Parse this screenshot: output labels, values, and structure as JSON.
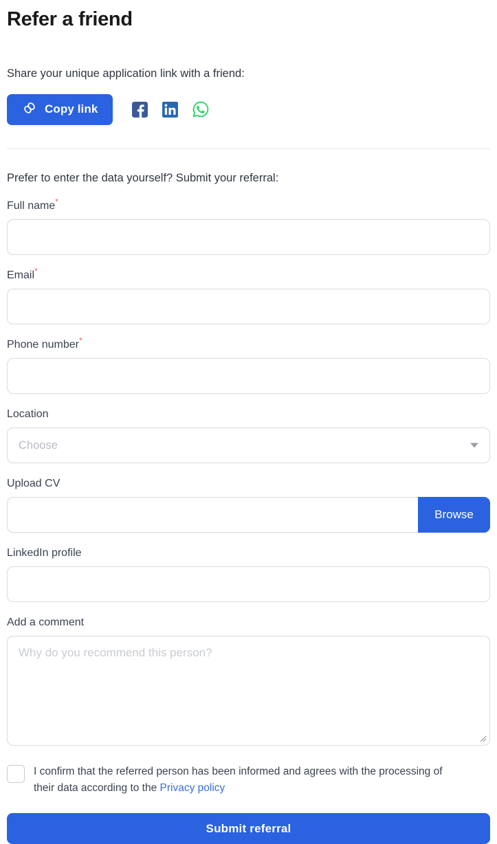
{
  "page": {
    "title": "Refer a friend"
  },
  "share": {
    "prompt": "Share your unique application link with a friend:",
    "copy_link_label": "Copy link",
    "copy_link_icon": "link-chain-icon",
    "socials": [
      {
        "name": "facebook-share-icon",
        "label": "Facebook",
        "color": "#3b5998"
      },
      {
        "name": "linkedin-share-icon",
        "label": "LinkedIn",
        "color": "#2867b2"
      },
      {
        "name": "whatsapp-share-icon",
        "label": "WhatsApp",
        "color": "#25d366"
      }
    ]
  },
  "form": {
    "intro": "Prefer to enter the data yourself? Submit your referral:",
    "required_marker": "*",
    "fields": {
      "full_name": {
        "label": "Full name",
        "required": true,
        "value": "",
        "placeholder": ""
      },
      "email": {
        "label": "Email",
        "required": true,
        "value": "",
        "placeholder": ""
      },
      "phone": {
        "label": "Phone number",
        "required": true,
        "value": "",
        "placeholder": ""
      },
      "location": {
        "label": "Location",
        "required": false,
        "selected": "Choose",
        "icon": "chevron-down-icon"
      },
      "upload_cv": {
        "label": "Upload CV",
        "required": false,
        "value": "",
        "placeholder": "",
        "browse_label": "Browse"
      },
      "linkedin": {
        "label": "LinkedIn profile",
        "required": false,
        "value": "",
        "placeholder": ""
      },
      "comment": {
        "label": "Add a comment",
        "required": false,
        "value": "",
        "placeholder": "Why do you recommend this person?"
      }
    },
    "consent": {
      "text_before": "I confirm that the referred person has been informed and agrees with the processing of their data according to the ",
      "link_label": "Privacy policy",
      "checked": false
    },
    "submit_label": "Submit referral"
  },
  "colors": {
    "primary": "#2a62e0",
    "link": "#3a6fd8",
    "required": "#f2605d",
    "border": "#d8dade",
    "placeholder": "#c4c7cc"
  }
}
